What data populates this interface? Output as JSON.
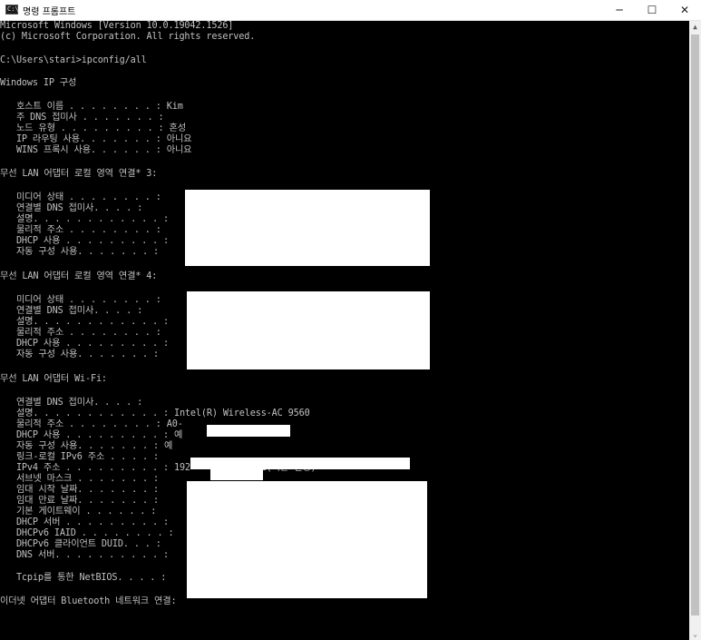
{
  "window": {
    "icon_text": "C:\\",
    "title": "명령 프롬프트",
    "minimize": "─",
    "maximize": "☐",
    "close": "✕"
  },
  "console": {
    "lines": [
      "Microsoft Windows [Version 10.0.19042.1526]",
      "(c) Microsoft Corporation. All rights reserved.",
      "C:\\Users\\stari>ipconfig/all",
      "Windows IP 구성",
      "   호스트 이름 . . . . . . . . : Kim",
      "   주 DNS 접미사 . . . . . . . :",
      "   노드 유형 . . . . . . . . . : 혼성",
      "   IP 라우팅 사용. . . . . . . : 아니요",
      "   WINS 프록시 사용. . . . . . : 아니요",
      "무선 LAN 어댑터 로컬 영역 연결* 3:",
      "   미디어 상태 . . . . . . . . :",
      "   연결별 DNS 접미사. . . . :",
      "   설명. . . . . . . . . . . . :",
      "   물리적 주소 . . . . . . . . :",
      "   DHCP 사용 . . . . . . . . . :",
      "   자동 구성 사용. . . . . . . :",
      "무선 LAN 어댑터 로컬 영역 연결* 4:",
      "   미디어 상태 . . . . . . . . :",
      "   연결별 DNS 접미사. . . . :",
      "   설명. . . . . . . . . . . . :",
      "   물리적 주소 . . . . . . . . :",
      "   DHCP 사용 . . . . . . . . . :",
      "   자동 구성 사용. . . . . . . :",
      "무선 LAN 어댑터 Wi-Fi:",
      "   연결별 DNS 접미사. . . . :",
      "   설명. . . . . . . . . . . . : Intel(R) Wireless-AC 9560",
      "   물리적 주소 . . . . . . . . : A0-",
      "   DHCP 사용 . . . . . . . . . : 예",
      "   자동 구성 사용. . . . . . . : 예",
      "   링크-로컬 IPv6 주소 . . . . :",
      "   IPv4 주소 . . . . . . . . . : 192            01(기본 설정)",
      "   서브넷 마스크 . . . . . . . :",
      "   임대 시작 날짜. . . . . . . :",
      "   임대 만료 날짜. . . . . . . :",
      "   기본 게이트웨이 . . . . . . :",
      "   DHCP 서버 . . . . . . . . . :",
      "   DHCPv6 IAID . . . . . . . . :",
      "   DHCPv6 클라이언트 DUID. . . :",
      "   DNS 서버. . . . . . . . . . :",
      "   Tcpip를 통한 NetBIOS. . . . :",
      "이더넷 어댑터 Bluetooth 네트워크 연결:"
    ]
  },
  "scrollbar": {
    "up": "▲",
    "down": "⌄"
  }
}
